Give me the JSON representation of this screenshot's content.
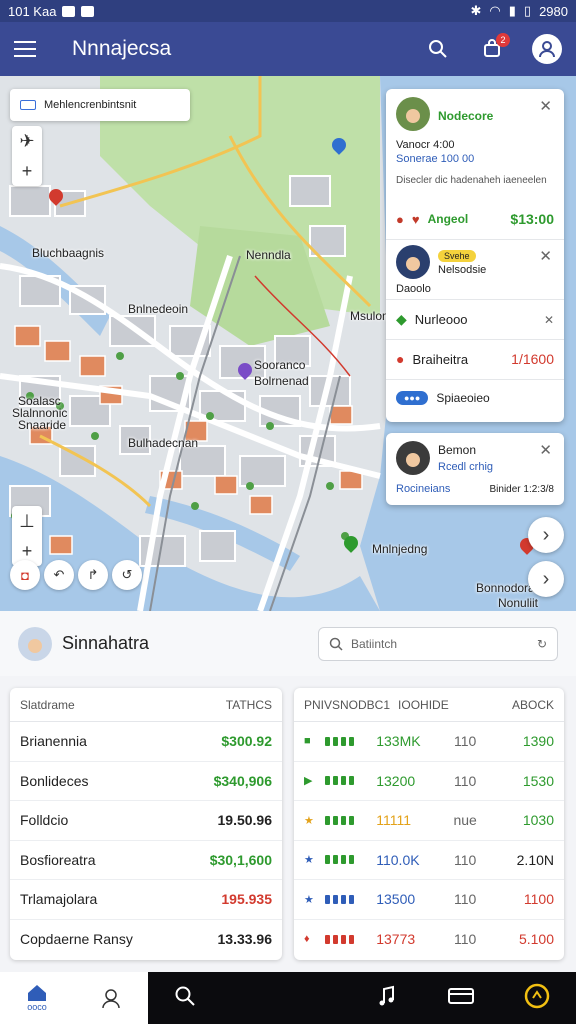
{
  "status_bar": {
    "left_text": "101 Kaa",
    "time": "2980"
  },
  "app_bar": {
    "title": "Nnnajecsa",
    "cart_badge": "2"
  },
  "map": {
    "search_chip": "Mehlencrenbintsnit",
    "labels": [
      "Bluchbaagnis",
      "Bnlnedeoin",
      "Sooranco",
      "Soalasc",
      "Bolrnenad",
      "Slalnnonic",
      "Snaaride",
      "Bulhadecnan",
      "Nenndla",
      "Msulomba",
      "Mnlnjedng",
      "Bonnodora",
      "Nonuliit"
    ],
    "colors": {
      "water": "#a7c8e8",
      "park": "#bfe0a8",
      "road": "#ffffff",
      "main_road": "#f2c453",
      "building": "#c9ccd2",
      "roof": "#e08a5f"
    }
  },
  "panel_top": {
    "item1": {
      "name": "Nodecore",
      "sub": "Vanocr 4:00",
      "sub2": "Sonerae 100 00",
      "desc": "Disecler dic hadenaheh iaeneelen",
      "tag": "Angeol",
      "price": "$13:00"
    },
    "item2": {
      "badge": "Svehe",
      "name": "Nelsodsie",
      "sub": "Daoolo"
    },
    "rows": [
      {
        "icon": "leaf",
        "label": "Nurleooo",
        "value": ""
      },
      {
        "icon": "pin",
        "label": "Braiheitra",
        "value": "1/1600"
      },
      {
        "icon": "cloud",
        "label": "Spiaeoieo",
        "value": ""
      }
    ]
  },
  "panel_bottom": {
    "name": "Bemon",
    "sub": "Rcedl crhig",
    "link": "Rocineians",
    "meta": "Binider 1:2:3/8"
  },
  "user_bar": {
    "name": "Sinnahatra",
    "search_placeholder": "Batiintch"
  },
  "left_table": {
    "header_left": "Slatdrame",
    "header_right": "TATHCS",
    "rows": [
      {
        "label": "Brianennia",
        "amount": "$300.92",
        "color": "#2e9a2e"
      },
      {
        "label": "Bonlideces",
        "amount": "$340,906",
        "color": "#2e9a2e"
      },
      {
        "label": "Folldcio",
        "amount": "19.50.96",
        "color": "#222222"
      },
      {
        "label": "Bosfioreatra",
        "amount": "$30,1,600",
        "color": "#2e9a2e"
      },
      {
        "label": "Trlamajolara",
        "amount": "195.935",
        "color": "#d23a2e"
      },
      {
        "label": "Copdaerne Ransy",
        "amount": "13.33.96",
        "color": "#222222"
      }
    ]
  },
  "right_table": {
    "header_left": "PNIVSNODBC1",
    "header_mid": "IOOHIDE",
    "header_right": "ABOCK",
    "rows": [
      {
        "mark": "■",
        "mark_color": "#2e9a2e",
        "dot_color": "#2e9a2e",
        "v1": "133MK",
        "v1_color": "#2e9a2e",
        "v2": "110",
        "v3": "1390",
        "v3_color": "#2e9a2e"
      },
      {
        "mark": "▶",
        "mark_color": "#2e9a2e",
        "dot_color": "#2e9a2e",
        "v1": "13200",
        "v1_color": "#2e9a2e",
        "v2": "110",
        "v3": "1530",
        "v3_color": "#2e9a2e"
      },
      {
        "mark": "★",
        "mark_color": "#e3a21a",
        "dot_color": "#2e9a2e",
        "v1": "11111",
        "v1_color": "#e3a21a",
        "v2": "nue",
        "v3": "1030",
        "v3_color": "#2e9a2e"
      },
      {
        "mark": "★",
        "mark_color": "#2f5db8",
        "dot_color": "#2e9a2e",
        "v1": "110.0K",
        "v1_color": "#2f5db8",
        "v2": "110",
        "v3": "2.10N",
        "v3_color": "#222222"
      },
      {
        "mark": "★",
        "mark_color": "#2f5db8",
        "dot_color": "#2f5db8",
        "v1": "13500",
        "v1_color": "#2f5db8",
        "v2": "110",
        "v3": "1100",
        "v3_color": "#d23a2e"
      },
      {
        "mark": "♦",
        "mark_color": "#d23a2e",
        "dot_color": "#d23a2e",
        "v1": "13773",
        "v1_color": "#d23a2e",
        "v2": "110",
        "v3": "5.100",
        "v3_color": "#d23a2e"
      }
    ]
  },
  "bottom_nav": {
    "home_label": "ooco"
  }
}
